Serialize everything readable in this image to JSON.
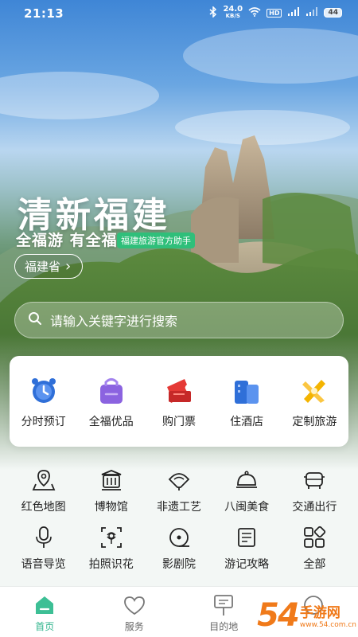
{
  "status_bar": {
    "time": "21:13",
    "net_speed": "24.0",
    "net_unit": "KB/S",
    "hd": "HD",
    "battery": "44"
  },
  "hero": {
    "title": "清新福建",
    "subtitle": "全福游 有全福",
    "badge": "福建旅游官方助手",
    "region": "福建省",
    "region_chevron": "›"
  },
  "search": {
    "placeholder": "请输入关键字进行搜索"
  },
  "categories": [
    {
      "label": "分时预订",
      "icon": "alarm-clock-icon",
      "color": "#2f6fd8"
    },
    {
      "label": "全福优品",
      "icon": "shopping-bag-icon",
      "color": "#8b63e0"
    },
    {
      "label": "购门票",
      "icon": "ticket-icon",
      "color": "#e53935"
    },
    {
      "label": "住酒店",
      "icon": "hotel-icon",
      "color": "#2f6fd8"
    },
    {
      "label": "定制旅游",
      "icon": "custom-tour-icon",
      "color": "#f4b400"
    }
  ],
  "services": [
    {
      "label": "红色地图",
      "icon": "map-pin-icon"
    },
    {
      "label": "博物馆",
      "icon": "museum-icon"
    },
    {
      "label": "非遗工艺",
      "icon": "fan-icon"
    },
    {
      "label": "八闽美食",
      "icon": "dish-cloche-icon"
    },
    {
      "label": "交通出行",
      "icon": "car-icon"
    },
    {
      "label": "语音导览",
      "icon": "microphone-icon"
    },
    {
      "label": "拍照识花",
      "icon": "camera-flower-icon"
    },
    {
      "label": "影剧院",
      "icon": "film-reel-icon"
    },
    {
      "label": "游记攻略",
      "icon": "notes-icon"
    },
    {
      "label": "全部",
      "icon": "all-grid-icon"
    }
  ],
  "bottom_nav": [
    {
      "label": "首页",
      "icon": "home-icon",
      "active": true
    },
    {
      "label": "服务",
      "icon": "heart-icon",
      "active": false
    },
    {
      "label": "目的地",
      "icon": "signpost-icon",
      "active": false
    },
    {
      "label": "",
      "icon": "profile-icon",
      "active": false
    }
  ],
  "watermark": {
    "number": "54",
    "cn": "手游网",
    "url": "www.54.com.cn"
  },
  "colors": {
    "accent": "#2fb48c",
    "badge": "#2fbf7a",
    "watermark": "#f07a1a"
  }
}
